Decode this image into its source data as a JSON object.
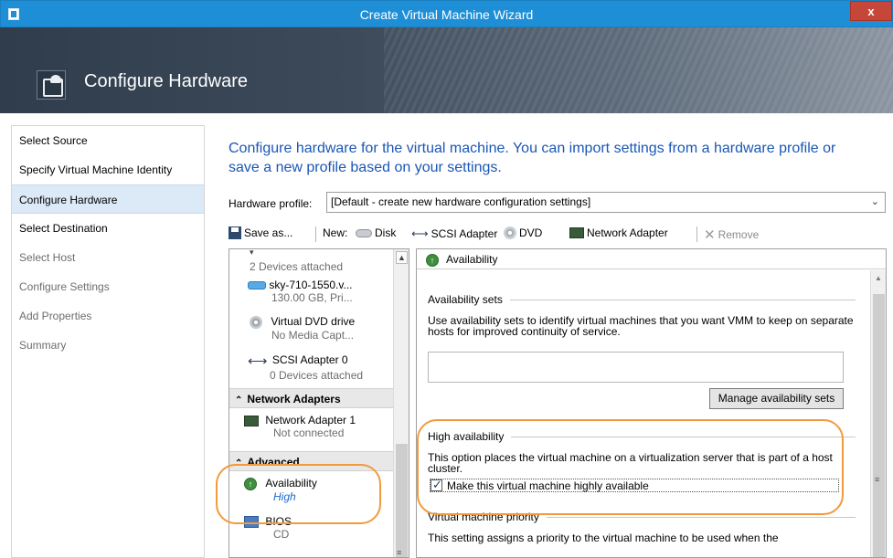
{
  "window": {
    "title": "Create Virtual Machine Wizard",
    "close_label": "x"
  },
  "header": {
    "title": "Configure Hardware",
    "icon": "configure-hardware-icon"
  },
  "nav": {
    "items": [
      {
        "label": "Select Source",
        "state": "enabled"
      },
      {
        "label": "Specify Virtual Machine Identity",
        "state": "enabled"
      },
      {
        "label": "Configure Hardware",
        "state": "active"
      },
      {
        "label": "Select Destination",
        "state": "enabled"
      },
      {
        "label": "Select Host",
        "state": "disabled"
      },
      {
        "label": "Configure Settings",
        "state": "disabled"
      },
      {
        "label": "Add Properties",
        "state": "disabled"
      },
      {
        "label": "Summary",
        "state": "disabled"
      }
    ]
  },
  "main": {
    "intro": "Configure hardware for the virtual machine. You can import settings from a hardware profile or save a new profile based on your settings.",
    "hardware_profile_label": "Hardware profile:",
    "hardware_profile_value": "[Default - create new hardware configuration settings]"
  },
  "toolbar": {
    "save": "Save as...",
    "new_label": "New:",
    "disk": "Disk",
    "scsi": "SCSI Adapter",
    "dvd": "DVD",
    "network": "Network Adapter",
    "remove": "Remove"
  },
  "devices": {
    "ide_sub": "2 Devices attached",
    "vhd_name": "sky-710-1550.v...",
    "vhd_sub": "130.00 GB, Pri...",
    "dvd_name": "Virtual DVD drive",
    "dvd_sub": "No Media Capt...",
    "scsi_name": "SCSI Adapter 0",
    "scsi_sub": "0 Devices attached",
    "network_section": "Network Adapters",
    "net_name": "Network Adapter 1",
    "net_sub": "Not connected",
    "advanced_section": "Advanced",
    "avail_name": "Availability",
    "avail_sub": "High",
    "bios_name": "BIOS",
    "bios_sub": "CD"
  },
  "detail": {
    "header": "Availability",
    "avail_sets_title": "Availability sets",
    "avail_sets_desc": "Use availability sets to identify virtual machines that you want VMM to keep on separate hosts for improved continuity of service.",
    "manage_button": "Manage availability sets",
    "ha_title": "High availability",
    "ha_desc": "This option places the virtual machine on a virtualization server that is part of a host cluster.",
    "ha_checkbox": "Make this virtual machine highly available",
    "ha_checked": true,
    "priority_title": "Virtual machine priority",
    "priority_desc": "This setting assigns a priority to the virtual machine to be used when the"
  },
  "colors": {
    "titlebar": "#1e8fd6",
    "intro_text": "#1a57b5",
    "highlight_ring": "#f39a3c",
    "nav_active": "#dce9f6"
  }
}
